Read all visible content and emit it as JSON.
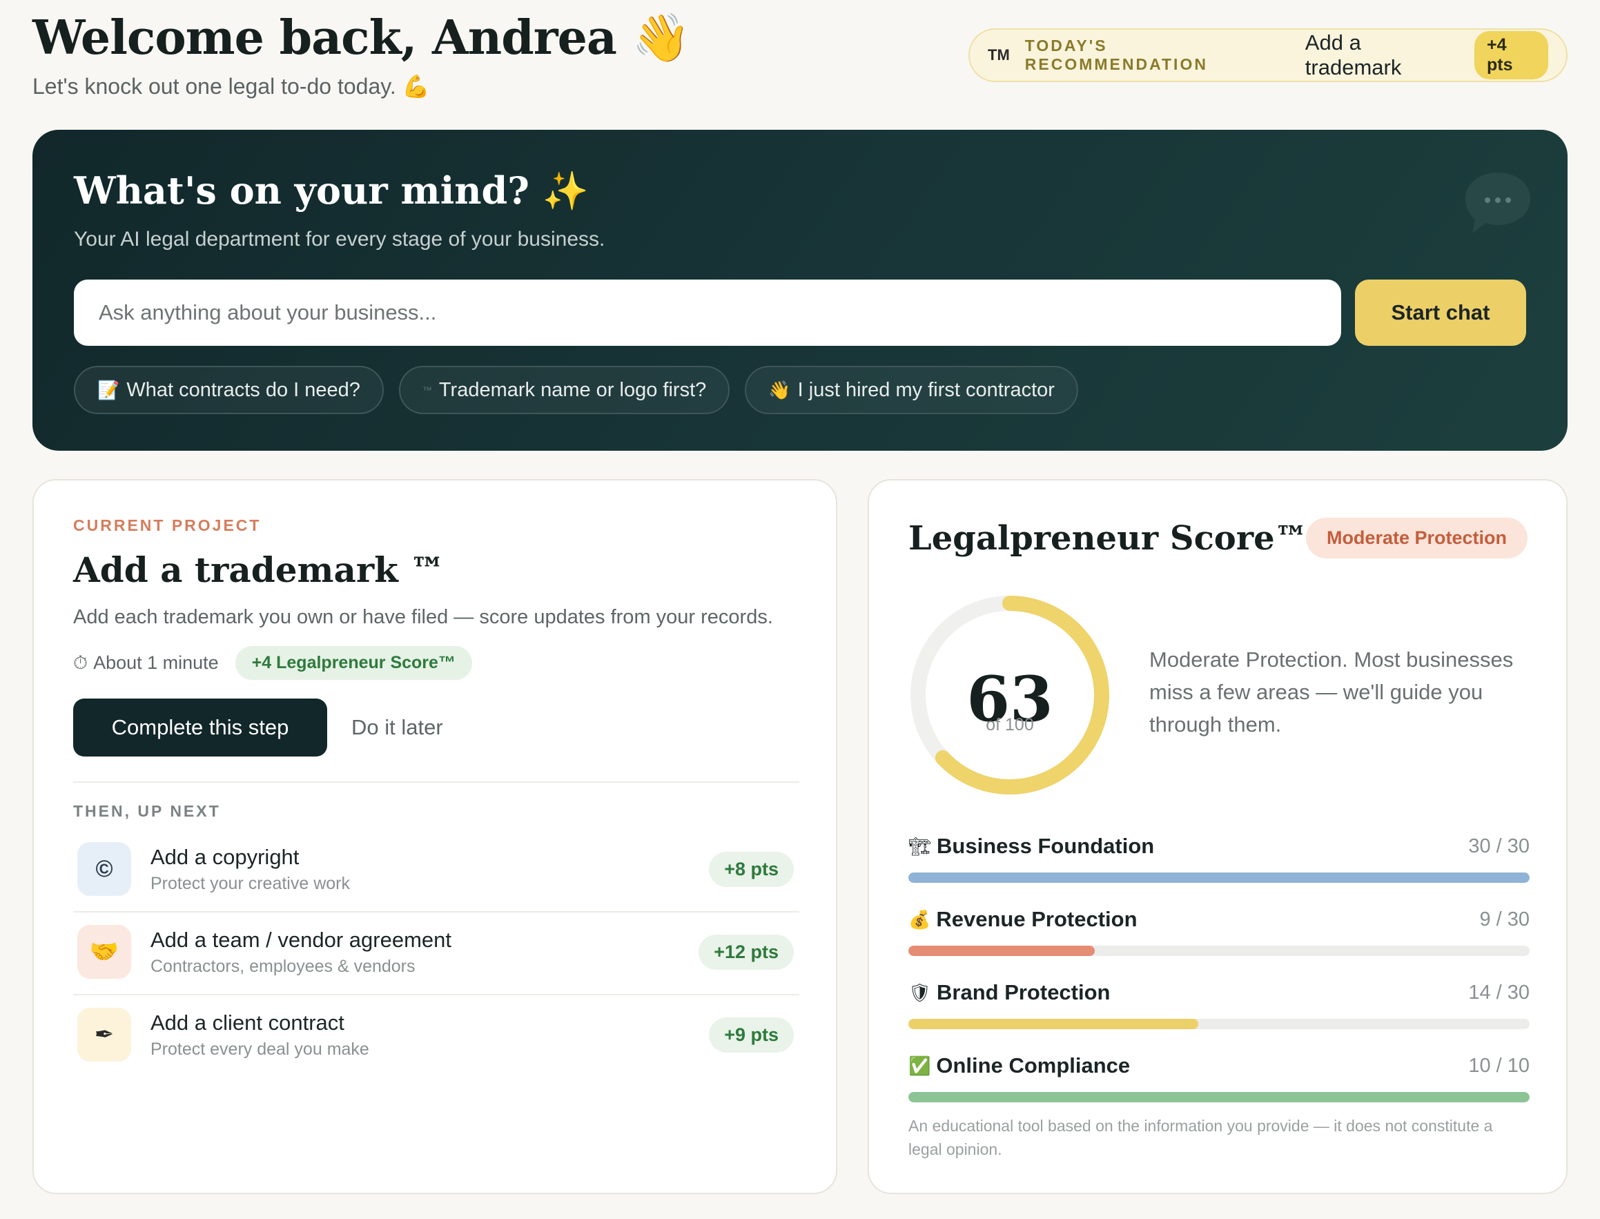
{
  "header": {
    "welcome": "Welcome back, Andrea 👋",
    "subtitle": "Let's knock out one legal to-do today. 💪"
  },
  "recommendation": {
    "icon": "TM",
    "label": "TODAY'S RECOMMENDATION",
    "title": "Add a trademark",
    "points": "+4 pts"
  },
  "hero": {
    "title": "What's on your mind? ✨",
    "subtitle": "Your AI legal department for every stage of your business.",
    "input_placeholder": "Ask anything about your business...",
    "start_label": "Start chat",
    "chips": [
      {
        "icon": "📝",
        "label": "What contracts do I need?"
      },
      {
        "icon": "™",
        "label": "Trademark name or logo first?"
      },
      {
        "icon": "👋",
        "label": "I just hired my first contractor"
      }
    ]
  },
  "project": {
    "eyebrow": "CURRENT PROJECT",
    "title": "Add a trademark ™",
    "description": "Add each trademark you own or have filed — score updates from your records.",
    "time_icon": "⏱",
    "time": "About 1 minute",
    "score_pill": "+4 Legalpreneur Score™",
    "complete_label": "Complete this step",
    "later_label": "Do it later",
    "next_label": "THEN, UP NEXT",
    "tasks": [
      {
        "icon": "©",
        "title": "Add a copyright",
        "subtitle": "Protect your creative work",
        "points": "+8 pts",
        "bg": "#e6eff8",
        "color": "#2c3e50"
      },
      {
        "icon": "🤝",
        "title": "Add a team / vendor agreement",
        "subtitle": "Contractors, employees & vendors",
        "points": "+12 pts",
        "bg": "#fbe8e1",
        "color": "#d08a3c"
      },
      {
        "icon": "✒",
        "title": "Add a client contract",
        "subtitle": "Protect every deal you make",
        "points": "+9 pts",
        "bg": "#fcf3da",
        "color": "#2a2a2a"
      }
    ]
  },
  "score": {
    "title": "Legalpreneur Score™",
    "badge": "Moderate Protection",
    "value": "63",
    "value_num": 63,
    "max": 100,
    "of_label": "of 100",
    "description": "Moderate Protection. Most businesses miss a few areas — we'll guide you through them.",
    "gauge_color": "#efd36b",
    "track_color": "#f0f0ee",
    "categories": [
      {
        "icon": "🏗",
        "name": "Business Foundation",
        "value": "30 / 30",
        "score": 30,
        "max": 30,
        "color": "#8fb3d6"
      },
      {
        "icon": "💰",
        "name": "Revenue Protection",
        "value": "9 / 30",
        "score": 9,
        "max": 30,
        "color": "#e58c74"
      },
      {
        "icon": "🛡",
        "name": "Brand Protection",
        "value": "14 / 30",
        "score": 14,
        "max": 30,
        "color": "#ecd068"
      },
      {
        "icon": "✅",
        "name": "Online Compliance",
        "value": "10 / 10",
        "score": 10,
        "max": 10,
        "color": "#8cc495"
      }
    ],
    "disclaimer": "An educational tool based on the information you provide — it does not constitute a legal opinion."
  }
}
